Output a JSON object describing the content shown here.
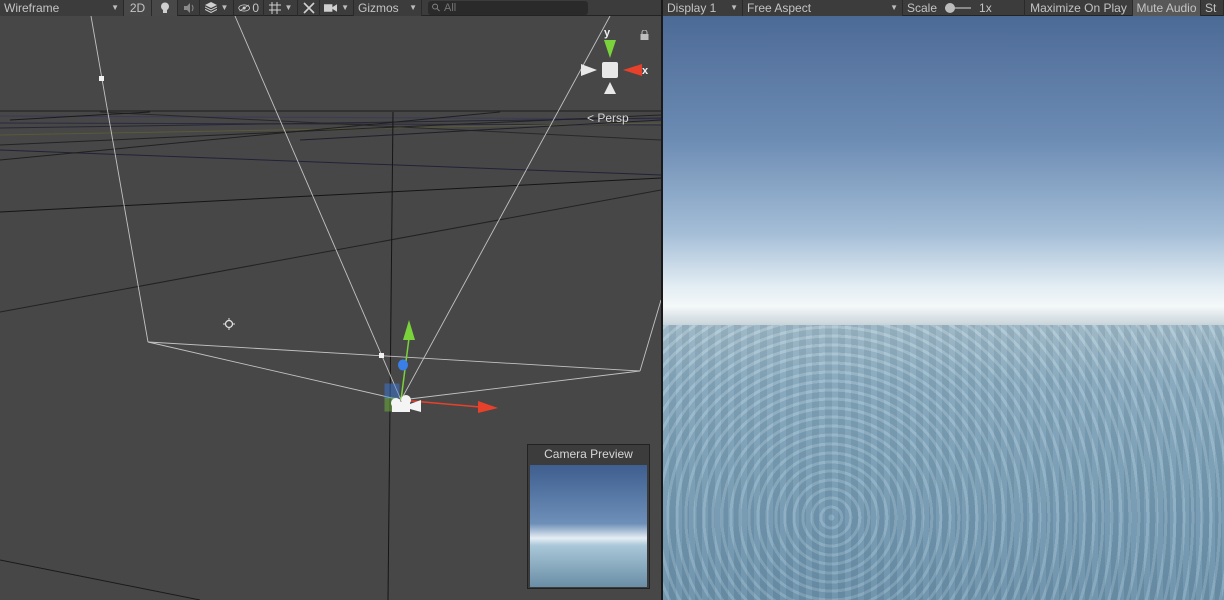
{
  "scene_toolbar": {
    "draw_mode": "Wireframe",
    "toggle_2d": "2D",
    "hidden_count": "0",
    "gizmos": "Gizmos",
    "search_placeholder": "All"
  },
  "scene_view": {
    "projection_label": "Persp",
    "axis_y": "y",
    "axis_x": "x",
    "camera_preview_title": "Camera Preview"
  },
  "game_toolbar": {
    "display": "Display 1",
    "aspect": "Free Aspect",
    "scale_label": "Scale",
    "scale_value": "1x",
    "maximize": "Maximize On Play",
    "mute": "Mute Audio",
    "stats": "St"
  },
  "colors": {
    "x_axis": "#e8412b",
    "y_axis": "#7ad33a",
    "z_axis": "#3a7ee8"
  },
  "icons": [
    "lightbulb-icon",
    "audio-icon",
    "effects-icon",
    "visibility-icon",
    "grid-icon",
    "tools-icon",
    "camera-icon",
    "search-icon",
    "lock-icon"
  ]
}
